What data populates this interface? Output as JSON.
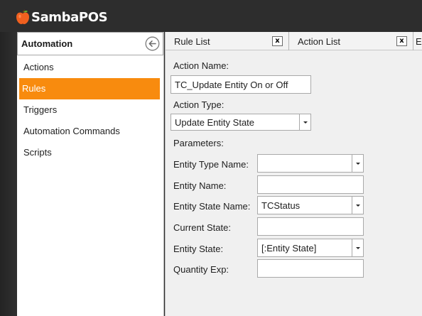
{
  "app": {
    "name": "SambaPOS",
    "logo_icon": "apple-logo-icon",
    "accent": "#f88b0e"
  },
  "sidebar": {
    "title": "Automation",
    "back_icon": "back-arrow-icon",
    "items": [
      {
        "label": "Actions",
        "active": false
      },
      {
        "label": "Rules",
        "active": true
      },
      {
        "label": "Triggers",
        "active": false
      },
      {
        "label": "Automation Commands",
        "active": false
      },
      {
        "label": "Scripts",
        "active": false
      }
    ]
  },
  "tabs": [
    {
      "label": "Rule List",
      "close": "x"
    },
    {
      "label": "Action List",
      "close": "x"
    },
    {
      "label": "E"
    }
  ],
  "form": {
    "action_name_label": "Action Name:",
    "action_name_value": "TC_Update Entity On or Off",
    "action_type_label": "Action Type:",
    "action_type_value": "Update Entity State",
    "parameters_label": "Parameters:",
    "fields": [
      {
        "label": "Entity Type Name:",
        "value": "",
        "kind": "combo"
      },
      {
        "label": "Entity Name:",
        "value": "",
        "kind": "text"
      },
      {
        "label": "Entity State Name:",
        "value": "TCStatus",
        "kind": "combo"
      },
      {
        "label": "Current State:",
        "value": "",
        "kind": "text"
      },
      {
        "label": "Entity State:",
        "value": "[:Entity State]",
        "kind": "combo"
      },
      {
        "label": "Quantity Exp:",
        "value": "",
        "kind": "text"
      }
    ]
  }
}
